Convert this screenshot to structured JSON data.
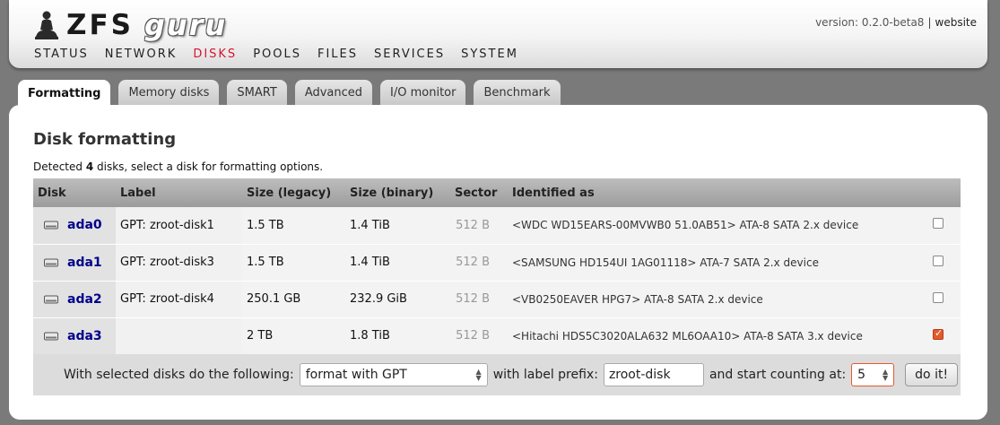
{
  "header": {
    "logo_zfs": "ZFS",
    "logo_guru": "guru",
    "version": "version: 0.2.0-beta8",
    "separator": "|",
    "website_link": "website"
  },
  "nav": [
    "STATUS",
    "NETWORK",
    "DISKS",
    "POOLS",
    "FILES",
    "SERVICES",
    "SYSTEM"
  ],
  "nav_active": "DISKS",
  "tabs": [
    "Formatting",
    "Memory disks",
    "SMART",
    "Advanced",
    "I/O monitor",
    "Benchmark"
  ],
  "tab_active": "Formatting",
  "page": {
    "title": "Disk formatting",
    "detected_prefix": "Detected ",
    "detected_count": "4",
    "detected_suffix": " disks, select a disk for formatting options."
  },
  "table": {
    "headers": [
      "Disk",
      "Label",
      "Size (legacy)",
      "Size (binary)",
      "Sector",
      "Identified as"
    ],
    "rows": [
      {
        "disk": "ada0",
        "label": "GPT: zroot-disk1",
        "legacy": "1.5 TB",
        "binary": "1.4 TiB",
        "sector": "512 B",
        "ident": "<WDC WD15EARS-00MVWB0 51.0AB51> ATA-8 SATA 2.x device",
        "checked": false
      },
      {
        "disk": "ada1",
        "label": "GPT: zroot-disk3",
        "legacy": "1.5 TB",
        "binary": "1.4 TiB",
        "sector": "512 B",
        "ident": "<SAMSUNG HD154UI 1AG01118> ATA-7 SATA 2.x device",
        "checked": false
      },
      {
        "disk": "ada2",
        "label": "GPT: zroot-disk4",
        "legacy": "250.1 GB",
        "binary": "232.9 GiB",
        "sector": "512 B",
        "ident": "<VB0250EAVER HPG7> ATA-8 SATA 2.x device",
        "checked": false
      },
      {
        "disk": "ada3",
        "label": "",
        "legacy": "2 TB",
        "binary": "1.8 TiB",
        "sector": "512 B",
        "ident": "<Hitachi HDS5C3020ALA632 ML6OAA10> ATA-8 SATA 3.x device",
        "checked": true
      }
    ]
  },
  "action": {
    "label1": "With selected disks do the following:",
    "format_select": "format with GPT",
    "label2": "with label prefix:",
    "prefix_value": "zroot-disk",
    "label3": "and start counting at:",
    "start_value": "5",
    "button": "do it!"
  },
  "colors": {
    "active_nav": "#d0102e",
    "disk_link": "#00008b",
    "checkbox_checked": "#e5592c"
  }
}
